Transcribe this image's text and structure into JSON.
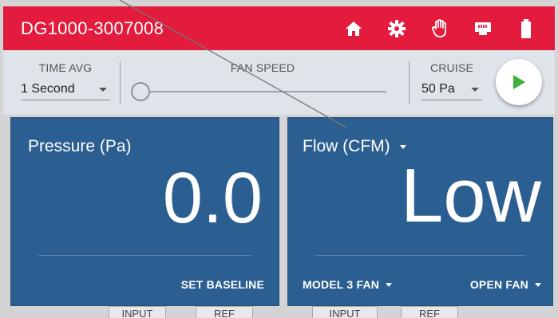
{
  "header": {
    "device_id": "DG1000-3007008",
    "icons": [
      "home-icon",
      "gear-icon",
      "hand-icon",
      "ethernet-icon",
      "battery-icon"
    ],
    "color": "#e31c3d"
  },
  "controls": {
    "time_avg": {
      "label": "TIME AVG",
      "value": "1 Second"
    },
    "fan_speed": {
      "label": "FAN SPEED",
      "level": 0
    },
    "cruise": {
      "label": "CRUISE",
      "value": "50 Pa"
    }
  },
  "left_panel": {
    "title": "Pressure (Pa)",
    "value": "0.0",
    "action": "SET BASELINE"
  },
  "right_panel": {
    "title": "Flow (CFM)",
    "value": "Low",
    "fan_model": "MODEL 3 FAN",
    "fan_config": "OPEN FAN"
  },
  "bottom_tabs": [
    "INPUT",
    "REF",
    "INPUT",
    "REF"
  ],
  "colors": {
    "panel": "#2c5f91",
    "play": "#3bb33b",
    "controls_bg": "#dfe3ea"
  }
}
